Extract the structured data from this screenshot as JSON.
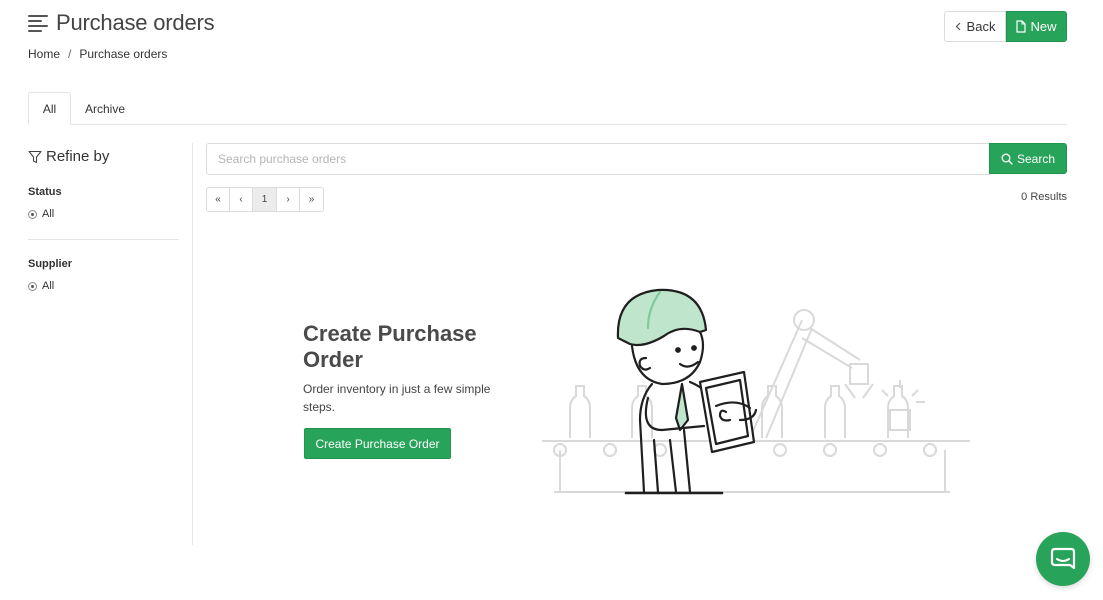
{
  "header": {
    "title": "Purchase orders",
    "back_label": "Back",
    "new_label": "New"
  },
  "breadcrumb": {
    "home": "Home",
    "separator": "/",
    "current": "Purchase orders"
  },
  "tabs": [
    {
      "label": "All",
      "active": true
    },
    {
      "label": "Archive",
      "active": false
    }
  ],
  "sidebar": {
    "refine_label": "Refine by",
    "filters": [
      {
        "label": "Status",
        "option": "All"
      },
      {
        "label": "Supplier",
        "option": "All"
      }
    ]
  },
  "search": {
    "placeholder": "Search purchase orders",
    "value": "",
    "button_label": "Search"
  },
  "pagination": {
    "first": "«",
    "prev": "‹",
    "current": "1",
    "next": "›",
    "last": "»"
  },
  "results_text": "0 Results",
  "empty_state": {
    "title": "Create Purchase Order",
    "description": "Order inventory in just a few simple steps.",
    "button_label": "Create Purchase Order",
    "illustration": "worker-with-tablet-factory-line"
  },
  "icons": {
    "menu": "hamburger-menu-icon",
    "back": "chevron-left-icon",
    "new": "document-icon",
    "filter": "funnel-icon",
    "search": "magnifier-icon",
    "chat": "chat-bubble-icon"
  },
  "colors": {
    "accent": "#27a35a",
    "border": "#dcdcdc",
    "text": "#333333"
  }
}
